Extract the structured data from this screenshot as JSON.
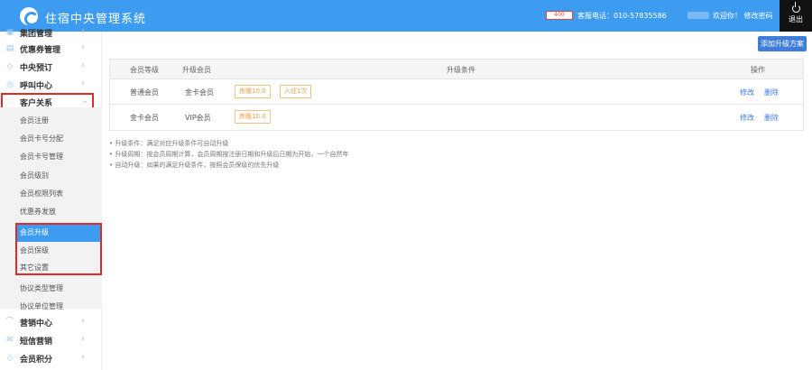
{
  "header": {
    "title": "住宿中央管理系统",
    "service_logo": "400",
    "service_text": "客服电话：010-57835586",
    "welcome_text": "欢迎你！ 修改密码",
    "logout_label": "退出"
  },
  "sidebar": {
    "items": [
      {
        "label": "集团管理",
        "icon": "building-icon"
      },
      {
        "label": "优惠券管理",
        "icon": "ticket-icon"
      },
      {
        "label": "中央预订",
        "icon": "tag-icon"
      },
      {
        "label": "呼叫中心",
        "icon": "phone-icon"
      },
      {
        "label": "客户关系",
        "icon": "heart-icon"
      }
    ],
    "sub_items": [
      {
        "label": "会员注册"
      },
      {
        "label": "会员卡号分配"
      },
      {
        "label": "会员卡号管理"
      },
      {
        "label": "会员级别"
      },
      {
        "label": "会员权限列表"
      },
      {
        "label": "优惠券发放"
      },
      {
        "label": "会员升级"
      },
      {
        "label": "会员保级"
      },
      {
        "label": "其它设置"
      },
      {
        "label": "协议类型管理"
      },
      {
        "label": "协议单位管理"
      }
    ],
    "bottom_items": [
      {
        "label": "营销中心",
        "icon": "megaphone-icon"
      },
      {
        "label": "短信营销",
        "icon": "mail-icon"
      },
      {
        "label": "会员积分",
        "icon": "diamond-icon"
      }
    ]
  },
  "main": {
    "add_button": "添加升级方案",
    "table": {
      "headers": [
        "会员等级",
        "升级会员",
        "升级条件",
        "操作"
      ],
      "rows": [
        {
          "level": "普通会员",
          "upgrade": "金卡会员",
          "conditions": [
            "房晚10.0",
            "入住1次"
          ],
          "edit": "修改",
          "delete": "删除"
        },
        {
          "level": "金卡会员",
          "upgrade": "VIP会员",
          "conditions": [
            "房晚10.0"
          ],
          "edit": "修改",
          "delete": "删除"
        }
      ]
    },
    "notes": [
      "• 升级条件：满足对应升级条件可自动升级",
      "• 升级周期：按会员周期计算，会员周期按注册日期和升级后日期为开始，一个自然年",
      "• 自动升级：如果的满足升级条件，按照会员保级的优先升级"
    ]
  }
}
